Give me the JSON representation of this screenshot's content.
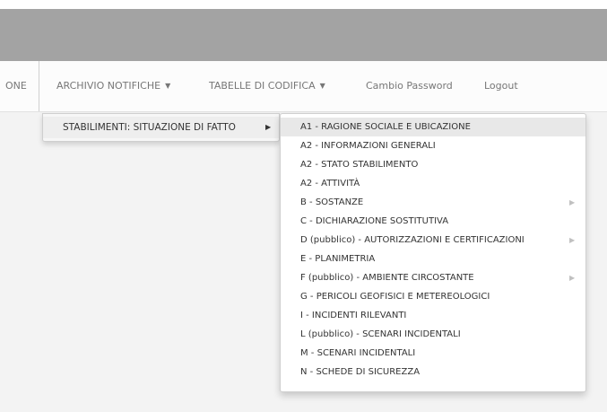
{
  "navbar": {
    "items": [
      {
        "label": "ONE",
        "caret": ""
      },
      {
        "label": "ARCHIVIO NOTIFICHE",
        "caret": "▼"
      },
      {
        "label": "TABELLE DI CODIFICA",
        "caret": "▼"
      },
      {
        "label": "Cambio Password",
        "caret": ""
      },
      {
        "label": "Logout",
        "caret": ""
      }
    ]
  },
  "submenu1": {
    "label": "STABILIMENTI: SITUAZIONE DI FATTO",
    "arrow": "▶"
  },
  "submenu2": {
    "items": [
      {
        "label": "A1 - RAGIONE SOCIALE E UBICAZIONE",
        "arrow": ""
      },
      {
        "label": "A2 - INFORMAZIONI GENERALI",
        "arrow": ""
      },
      {
        "label": "A2 - STATO STABILIMENTO",
        "arrow": ""
      },
      {
        "label": "A2 - ATTIVITÀ",
        "arrow": ""
      },
      {
        "label": "B - SOSTANZE",
        "arrow": "▶"
      },
      {
        "label": "C - DICHIARAZIONE SOSTITUTIVA",
        "arrow": ""
      },
      {
        "label": "D (pubblico) - AUTORIZZAZIONI E CERTIFICAZIONI",
        "arrow": "▶"
      },
      {
        "label": "E - PLANIMETRIA",
        "arrow": ""
      },
      {
        "label": "F (pubblico) - AMBIENTE CIRCOSTANTE",
        "arrow": "▶"
      },
      {
        "label": "G - PERICOLI GEOFISICI E METEREOLOGICI",
        "arrow": ""
      },
      {
        "label": "I - INCIDENTI RILEVANTI",
        "arrow": ""
      },
      {
        "label": "L (pubblico) - SCENARI INCIDENTALI",
        "arrow": ""
      },
      {
        "label": "M - SCENARI INCIDENTALI",
        "arrow": ""
      },
      {
        "label": "N - SCHEDE DI SICUREZZA",
        "arrow": ""
      }
    ]
  }
}
